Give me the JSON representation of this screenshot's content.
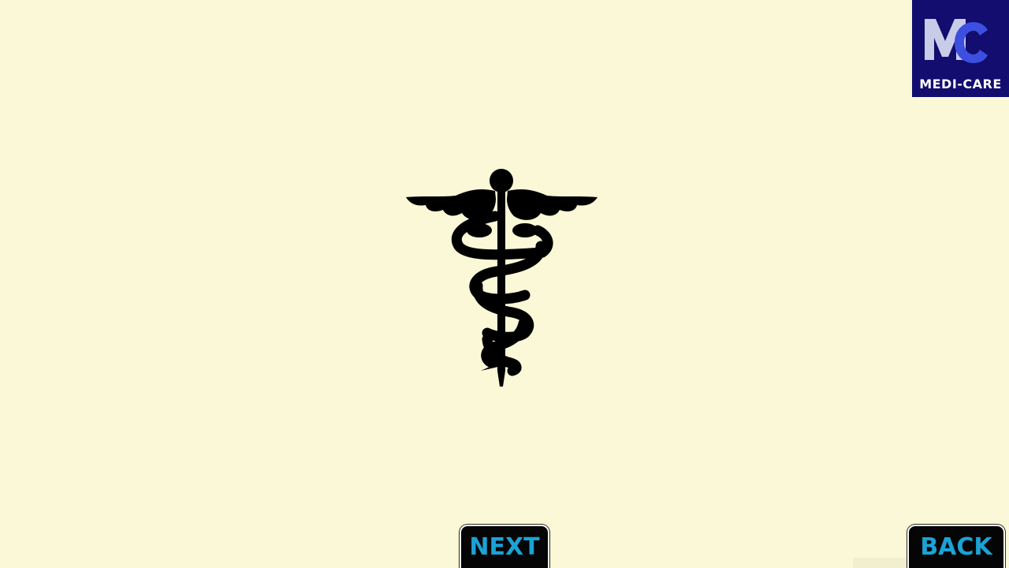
{
  "logo": {
    "monogram": "MC",
    "label": "MEDI-CARE",
    "background": "#120d6e",
    "m_color": "#c9cce8",
    "c_color": "#3c4fe0"
  },
  "emblem": {
    "icon": "caduceus-icon",
    "color": "#000000"
  },
  "navigation": {
    "next_label": "NEXT",
    "back_label": "BACK",
    "button_background": "#050505",
    "button_text_color": "#1ba3d6"
  },
  "background_color": "#faf8d6"
}
